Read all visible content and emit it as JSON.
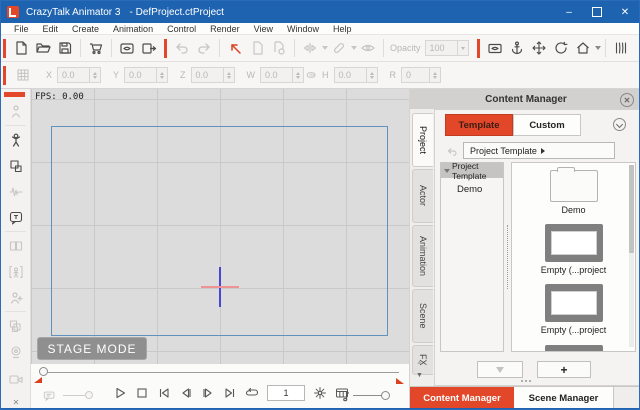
{
  "titlebar": {
    "app_name": "CrazyTalk Animator 3",
    "doc_name": "- DefProject.ctProject"
  },
  "icons": {
    "minimize": "–",
    "close": "✕"
  },
  "menu": {
    "items": [
      "File",
      "Edit",
      "Create",
      "Animation",
      "Control",
      "Render",
      "View",
      "Window",
      "Help"
    ]
  },
  "toolbar": {
    "opacity_label": "Opacity",
    "opacity_value": "100"
  },
  "transform": {
    "x_label": "X",
    "x_value": "0.0",
    "y_label": "Y",
    "y_value": "0.0",
    "z_label": "Z",
    "z_value": "0.0",
    "w_label": "W",
    "w_value": "0.0",
    "h_label": "H",
    "h_value": "0.0",
    "r_label": "R",
    "r_value": "0"
  },
  "canvas": {
    "fps": "FPS: 0.00",
    "stage_mode": "STAGE MODE"
  },
  "transport": {
    "frame": "1"
  },
  "content_manager": {
    "title": "Content Manager",
    "template_tab": "Template",
    "custom_tab": "Custom",
    "breadcrumb": "Project Template",
    "vertical_tabs": [
      "Project",
      "Actor",
      "Animation",
      "Scene",
      "FX"
    ],
    "tree_root": "Project Template",
    "tree_item": "Demo",
    "thumbnails": [
      {
        "label": "Demo",
        "type": "folder"
      },
      {
        "label": "Empty (...project",
        "type": "project"
      },
      {
        "label": "Empty (...project",
        "type": "project"
      }
    ],
    "add_label": "+"
  },
  "bottom_tabs": {
    "left": "Content Manager",
    "right": "Scene Manager"
  },
  "colors": {
    "accent": "#e2472a",
    "titlebar_blue": "#1e63b0",
    "stage_border": "#6191bd",
    "canvas_bg": "#dcdcdc"
  }
}
